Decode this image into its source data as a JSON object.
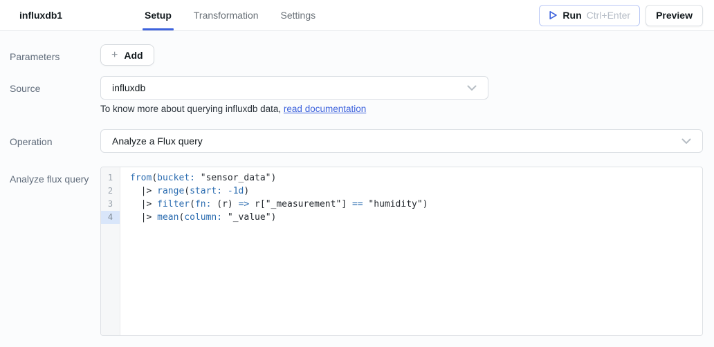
{
  "header": {
    "title": "influxdb1",
    "tabs": [
      {
        "label": "Setup",
        "active": true
      },
      {
        "label": "Transformation",
        "active": false
      },
      {
        "label": "Settings",
        "active": false
      }
    ],
    "run_label": "Run",
    "run_shortcut": "Ctrl+Enter",
    "preview_label": "Preview"
  },
  "form": {
    "parameters_label": "Parameters",
    "add_button_label": "Add",
    "source_label": "Source",
    "source_value": "influxdb",
    "source_help_text": "To know more about querying influxdb data, ",
    "source_help_link": "read documentation",
    "operation_label": "Operation",
    "operation_value": "Analyze a Flux query",
    "query_label": "Analyze flux query"
  },
  "editor": {
    "active_line": 4,
    "lines": [
      {
        "number": 1,
        "segments": [
          {
            "text": "from",
            "type": "kw"
          },
          {
            "text": "(",
            "type": "p"
          },
          {
            "text": "bucket:",
            "type": "kw"
          },
          {
            "text": " ",
            "type": "p"
          },
          {
            "text": "\"sensor_data\"",
            "type": "str"
          },
          {
            "text": ")",
            "type": "p"
          }
        ]
      },
      {
        "number": 2,
        "segments": [
          {
            "text": "  |> ",
            "type": "p"
          },
          {
            "text": "range",
            "type": "kw"
          },
          {
            "text": "(",
            "type": "p"
          },
          {
            "text": "start:",
            "type": "kw"
          },
          {
            "text": " ",
            "type": "p"
          },
          {
            "text": "-1d",
            "type": "num"
          },
          {
            "text": ")",
            "type": "p"
          }
        ]
      },
      {
        "number": 3,
        "segments": [
          {
            "text": "  |> ",
            "type": "p"
          },
          {
            "text": "filter",
            "type": "kw"
          },
          {
            "text": "(",
            "type": "p"
          },
          {
            "text": "fn:",
            "type": "kw"
          },
          {
            "text": " (r) ",
            "type": "p"
          },
          {
            "text": "=>",
            "type": "kw"
          },
          {
            "text": " r[",
            "type": "p"
          },
          {
            "text": "\"_measurement\"",
            "type": "str"
          },
          {
            "text": "] ",
            "type": "p"
          },
          {
            "text": "==",
            "type": "kw"
          },
          {
            "text": " ",
            "type": "p"
          },
          {
            "text": "\"humidity\"",
            "type": "str"
          },
          {
            "text": ")",
            "type": "p"
          }
        ]
      },
      {
        "number": 4,
        "segments": [
          {
            "text": "  |> ",
            "type": "p"
          },
          {
            "text": "mean",
            "type": "kw"
          },
          {
            "text": "(",
            "type": "p"
          },
          {
            "text": "column:",
            "type": "kw"
          },
          {
            "text": " ",
            "type": "p"
          },
          {
            "text": "\"_value\"",
            "type": "str"
          },
          {
            "text": ")",
            "type": "p"
          }
        ]
      }
    ]
  },
  "colors": {
    "accent": "#3e63dd",
    "link": "#3e63dd",
    "code_keyword": "#2b6cb0",
    "code_text": "#24292f",
    "active_line_bg": "#d9e6fa",
    "tab_inactive": "#697077",
    "label": "#5f6b7a"
  }
}
